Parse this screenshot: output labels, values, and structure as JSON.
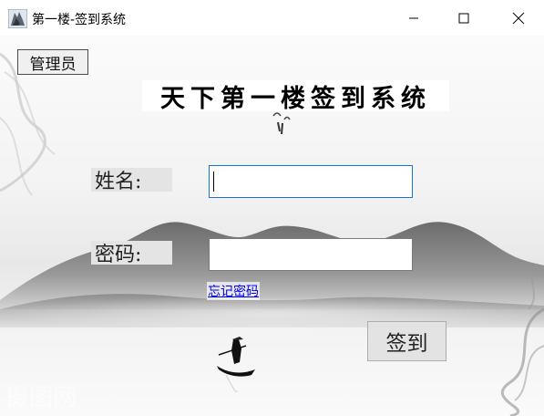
{
  "window": {
    "title": "第一楼-签到系统",
    "icon": "app-painting-icon",
    "controls": {
      "minimize_icon": "minimize-icon",
      "maximize_icon": "maximize-icon",
      "close_icon": "close-icon"
    }
  },
  "toolbar": {
    "admin_label": "管理员"
  },
  "form": {
    "heading": "天下第一楼签到系统",
    "name_label": "姓名:",
    "name_value": "",
    "password_label": "密码:",
    "password_value": "",
    "forgot_password_link": "忘记密码",
    "signin_label": "签到"
  },
  "colors": {
    "focus_border": "#1473d4",
    "link": "#0000ee"
  }
}
